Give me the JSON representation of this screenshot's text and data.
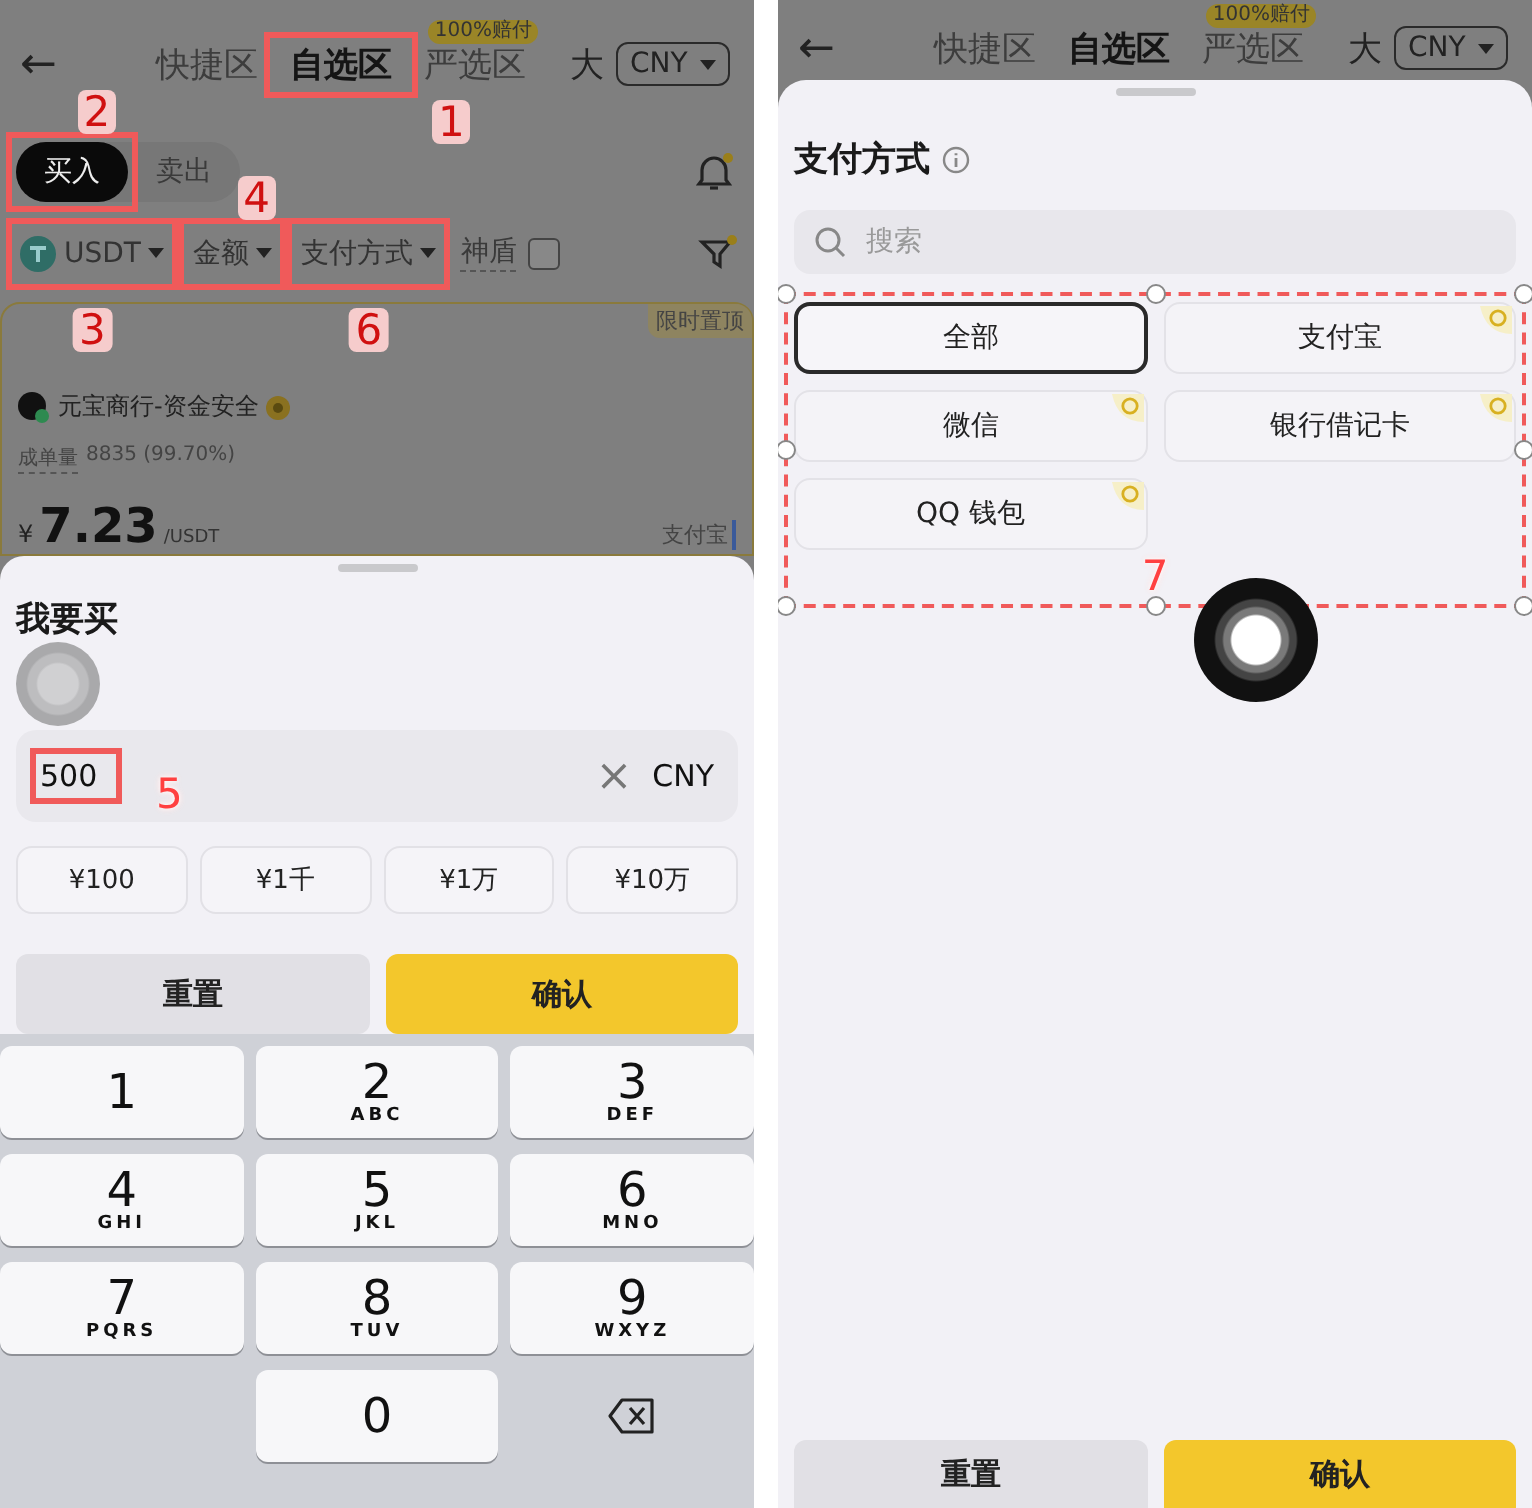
{
  "left": {
    "header": {
      "back": "←",
      "tabs": [
        {
          "label": "快捷区",
          "selected": false
        },
        {
          "label": "自选区",
          "selected": true,
          "annotation": {
            "number": "1",
            "kind": "box-below-right"
          }
        },
        {
          "label": "严选区",
          "selected": false,
          "badge": "100%赔付"
        }
      ],
      "size_toggle": "大",
      "currency": "CNY"
    },
    "trade_tabs": [
      {
        "label": "买入",
        "selected": true,
        "annotation": {
          "number": "2",
          "kind": "box-above"
        }
      },
      {
        "label": "卖出",
        "selected": false
      }
    ],
    "filters": [
      {
        "kind": "dropdown",
        "label": "USDT",
        "coin": true,
        "annotation": {
          "number": "3",
          "kind": "box-below"
        }
      },
      {
        "kind": "dropdown",
        "label": "金额",
        "annotation": {
          "number": "4",
          "kind": "box-above"
        }
      },
      {
        "kind": "dropdown",
        "label": "支付方式",
        "annotation": {
          "number": "6",
          "kind": "box-below"
        }
      },
      {
        "kind": "checkbox",
        "label": "神盾",
        "checked": false
      }
    ],
    "listing": {
      "tag": "限时置顶",
      "merchant": "元宝商行-资金安全",
      "stats_label": "成单量",
      "stats": "8835 (99.70%)",
      "currency_sign": "¥",
      "price": "7.23",
      "unit": "/USDT",
      "payment": "支付宝"
    },
    "sheet": {
      "title": "我要买",
      "amount": "500",
      "annotation": {
        "number": "5",
        "kind": "box-right"
      },
      "clear": "×",
      "currency": "CNY",
      "presets": [
        "¥100",
        "¥1千",
        "¥1万",
        "¥10万"
      ],
      "reset": "重置",
      "confirm": "确认"
    },
    "keypad": [
      {
        "kind": "key",
        "digit": "1"
      },
      {
        "kind": "key",
        "digit": "2",
        "letters": "ABC"
      },
      {
        "kind": "key",
        "digit": "3",
        "letters": "DEF"
      },
      {
        "kind": "key",
        "digit": "4",
        "letters": "GHI"
      },
      {
        "kind": "key",
        "digit": "5",
        "letters": "JKL"
      },
      {
        "kind": "key",
        "digit": "6",
        "letters": "MNO"
      },
      {
        "kind": "key",
        "digit": "7",
        "letters": "PQRS"
      },
      {
        "kind": "key",
        "digit": "8",
        "letters": "TUV"
      },
      {
        "kind": "key",
        "digit": "9",
        "letters": "WXYZ"
      },
      {
        "kind": "blank"
      },
      {
        "kind": "key",
        "digit": "0"
      },
      {
        "kind": "backspace"
      }
    ]
  },
  "right": {
    "header": {
      "back": "←",
      "tabs": [
        {
          "label": "快捷区",
          "selected": false
        },
        {
          "label": "自选区",
          "selected": true
        },
        {
          "label": "严选区",
          "selected": false,
          "badge": "100%赔付"
        }
      ],
      "size_toggle": "大",
      "currency": "CNY"
    },
    "sheet": {
      "title": "支付方式",
      "search_placeholder": "搜索",
      "annotation": {
        "number": "7",
        "kind": "selection"
      },
      "options": [
        {
          "label": "全部",
          "selected": true,
          "coin": false
        },
        {
          "label": "支付宝",
          "selected": false,
          "coin": true
        },
        {
          "label": "微信",
          "selected": false,
          "coin": true
        },
        {
          "label": "银行借记卡",
          "selected": false,
          "coin": true
        },
        {
          "label": "QQ 钱包",
          "selected": false,
          "coin": true
        }
      ],
      "reset": "重置",
      "confirm": "确认"
    }
  }
}
